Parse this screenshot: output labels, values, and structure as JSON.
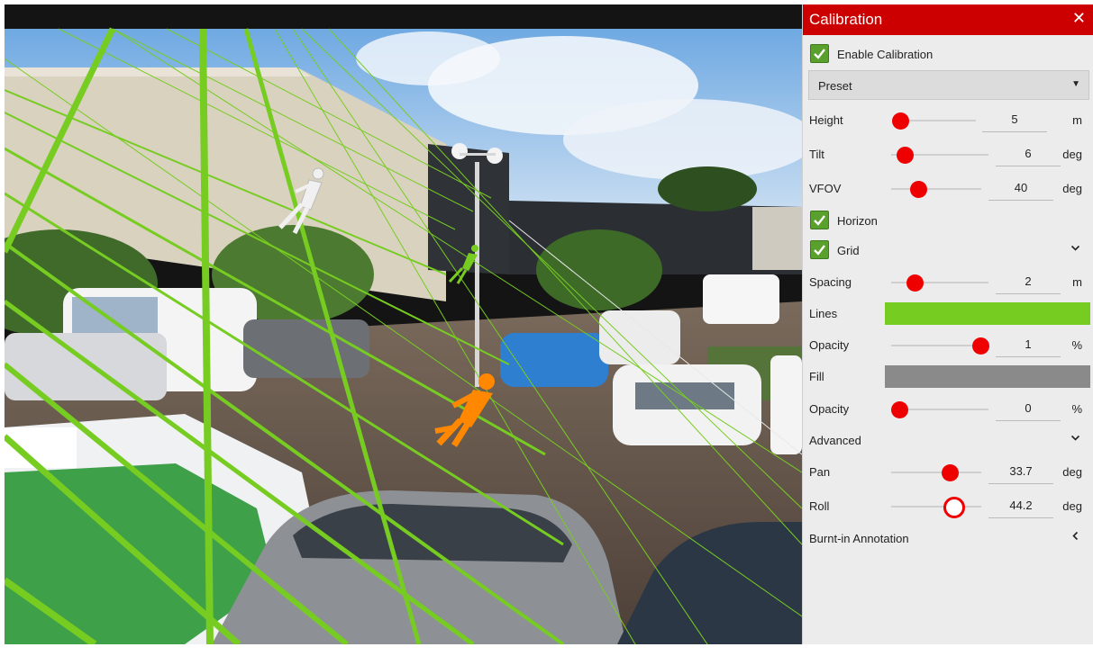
{
  "panel": {
    "title": "Calibration",
    "enable_calibration": {
      "label": "Enable Calibration",
      "checked": true
    },
    "preset": {
      "value": "Preset"
    },
    "height": {
      "label": "Height",
      "value": "5",
      "unit": "m",
      "level": 0.0
    },
    "tilt": {
      "label": "Tilt",
      "value": "6",
      "unit": "deg",
      "level": 0.06
    },
    "vfov": {
      "label": "VFOV",
      "value": "40",
      "unit": "deg",
      "level": 0.3
    },
    "horizon": {
      "label": "Horizon",
      "checked": true
    },
    "grid": {
      "label": "Grid",
      "checked": true
    },
    "spacing": {
      "label": "Spacing",
      "value": "2",
      "unit": "m",
      "level": 0.3
    },
    "lines": {
      "label": "Lines",
      "color": "#77cc22"
    },
    "lines_opacity": {
      "label": "Opacity",
      "value": "1",
      "unit": "%",
      "level": 1.0
    },
    "fill": {
      "label": "Fill",
      "color": "#8a8a8a"
    },
    "fill_opacity": {
      "label": "Opacity",
      "value": "0",
      "unit": "%",
      "level": 0.0
    },
    "advanced": {
      "label": "Advanced"
    },
    "pan": {
      "label": "Pan",
      "value": "33.7",
      "unit": "deg",
      "level": 0.7
    },
    "roll": {
      "label": "Roll",
      "value": "44.2",
      "unit": "deg",
      "level": 0.75
    },
    "burnt_in": {
      "label": "Burnt-in Annotation"
    }
  },
  "icons": {
    "close": "close-icon",
    "checkbox": "checkmark-icon",
    "dropdown": "caret-down-icon",
    "expand": "chevron-down-icon",
    "collapse": "chevron-left-icon"
  },
  "colors": {
    "accent": "#cc0000",
    "slider_thumb": "#ee0000",
    "checkbox": "#5aa02c",
    "grid_lines": "#77cc22"
  }
}
